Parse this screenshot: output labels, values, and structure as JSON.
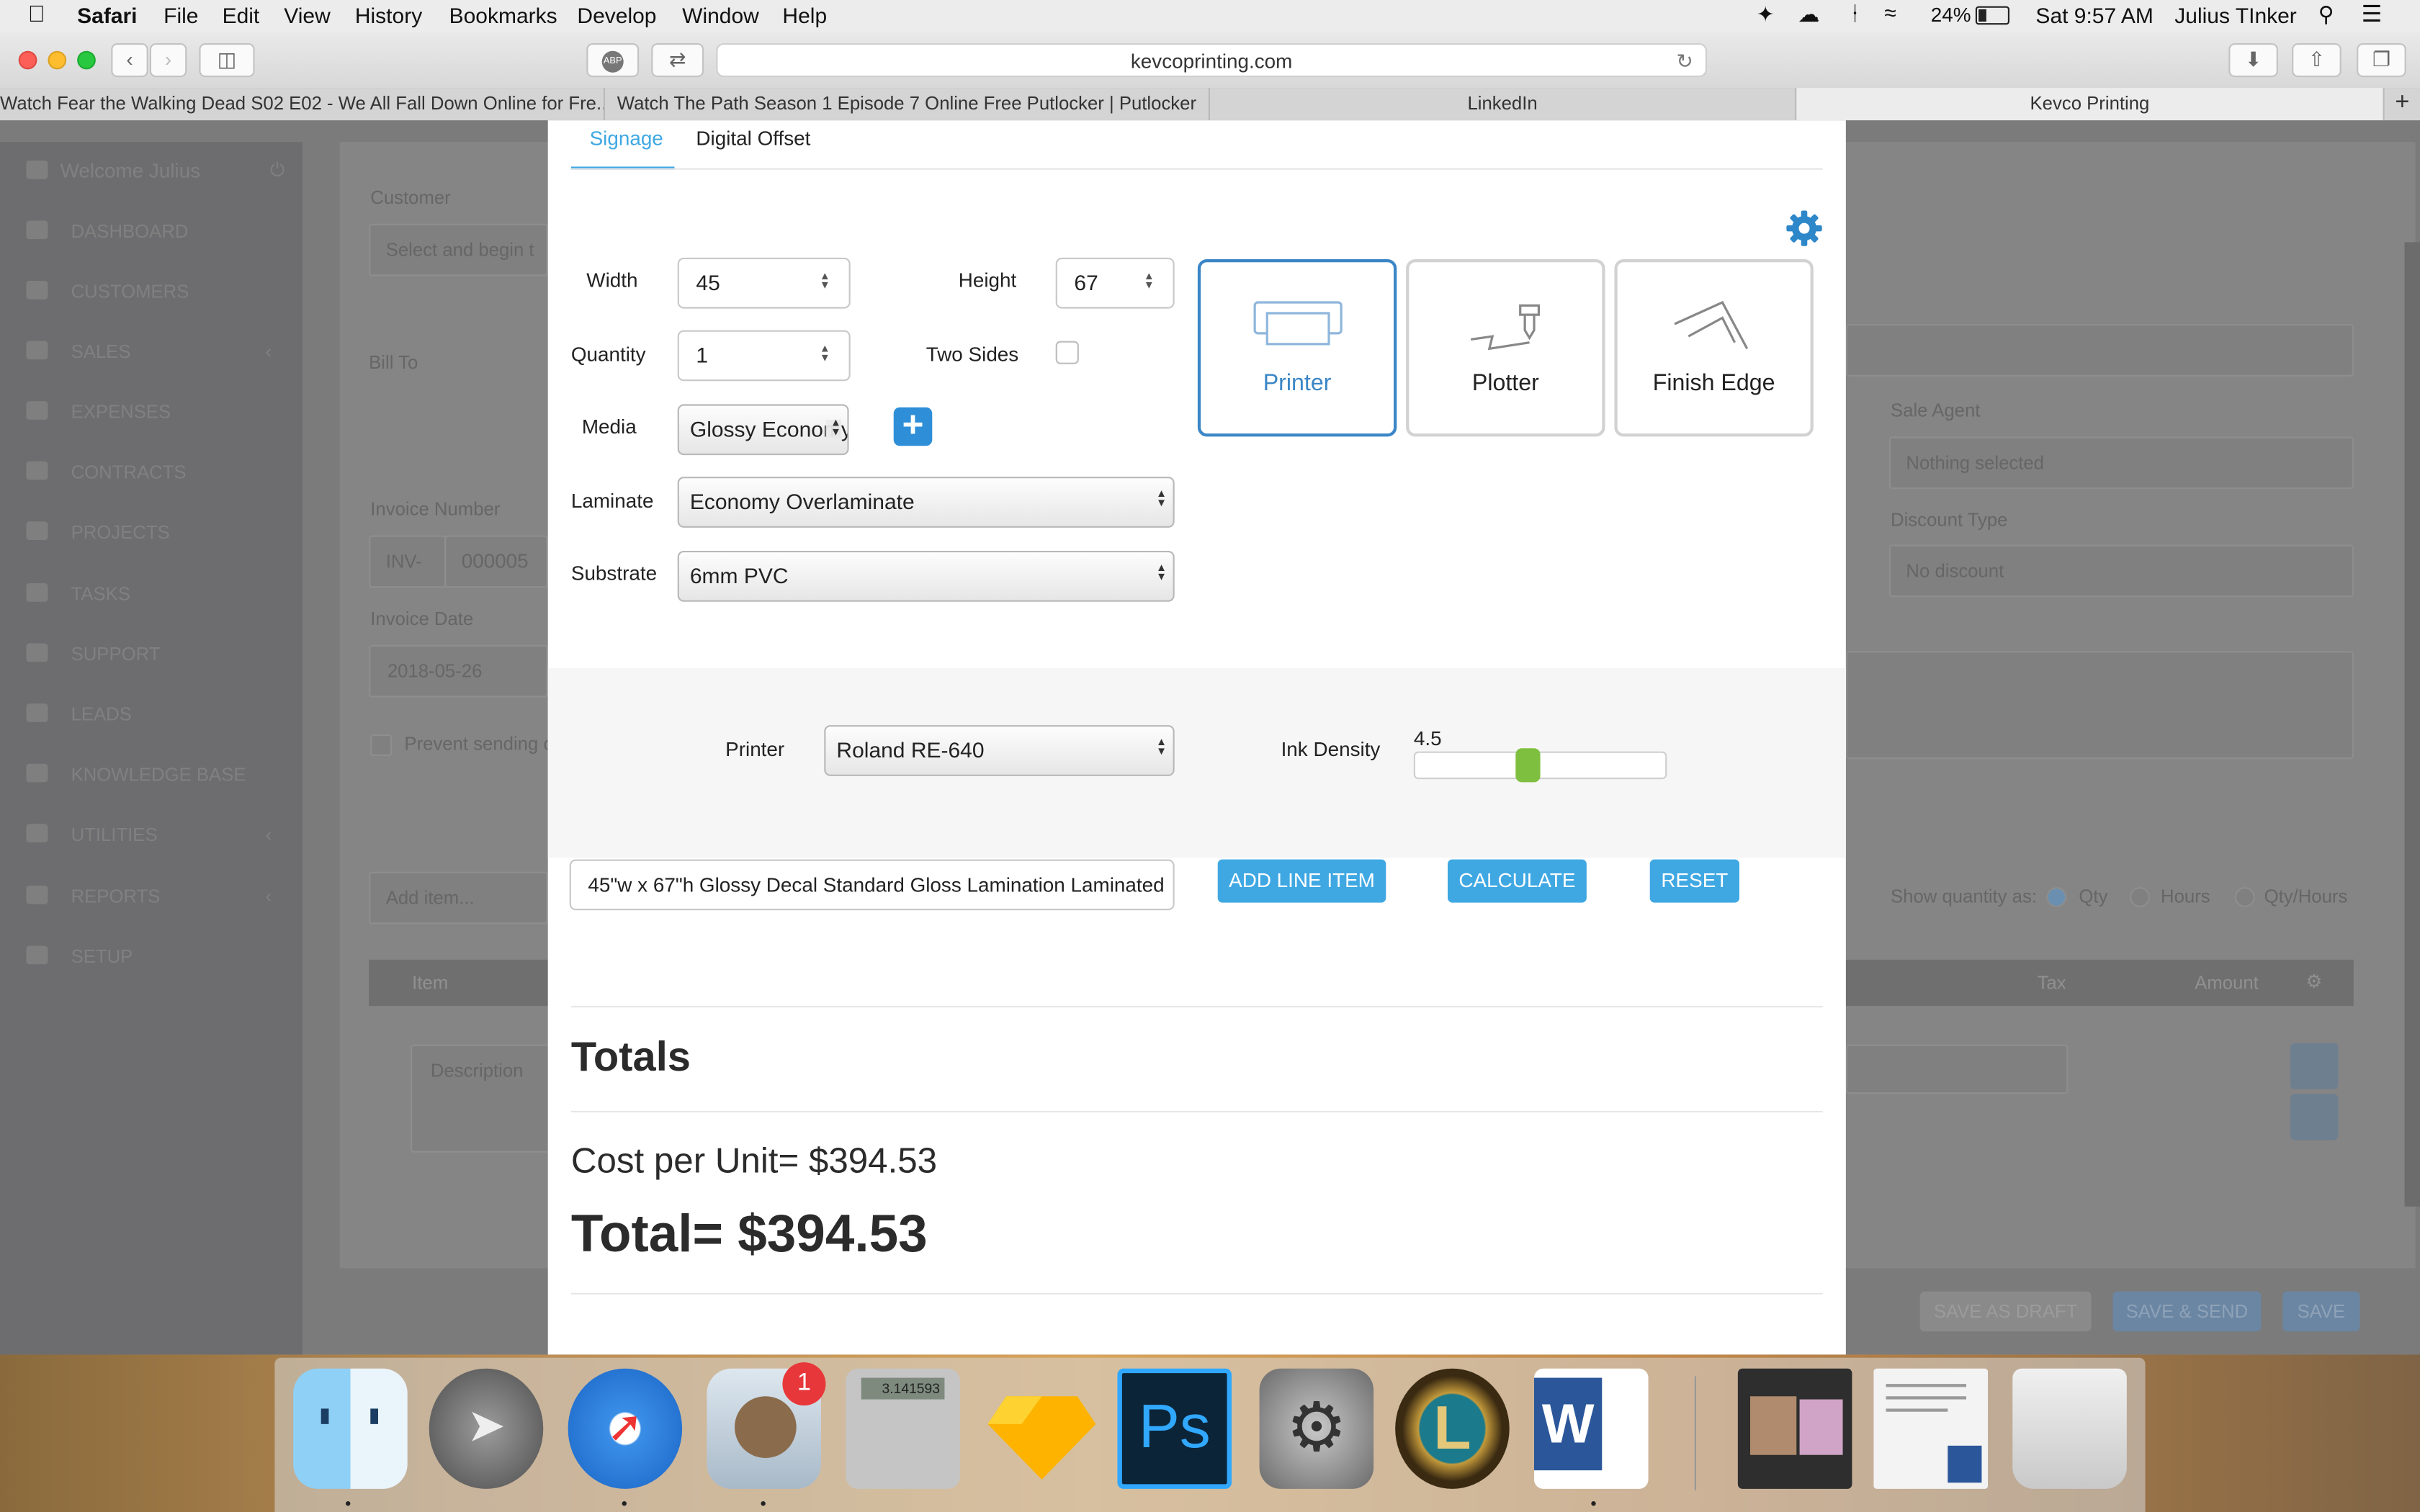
{
  "menubar": {
    "app": "Safari",
    "items": [
      "File",
      "Edit",
      "View",
      "History",
      "Bookmarks",
      "Develop",
      "Window",
      "Help"
    ],
    "battery": "24%",
    "clock": "Sat 9:57 AM",
    "user": "Julius TInker"
  },
  "browser": {
    "url": "kevcoprinting.com",
    "tabs": [
      "Watch Fear the Walking Dead S02 E02 - We All Fall Down Online for Fre...",
      "Watch The Path Season 1 Episode 7 Online Free Putlocker | Putlocker",
      "LinkedIn",
      "Kevco Printing"
    ],
    "active_tab": "Kevco Printing"
  },
  "sidebar": {
    "welcome": "Welcome Julius",
    "items": [
      "DASHBOARD",
      "CUSTOMERS",
      "SALES",
      "EXPENSES",
      "CONTRACTS",
      "PROJECTS",
      "TASKS",
      "SUPPORT",
      "LEADS",
      "KNOWLEDGE BASE",
      "UTILITIES",
      "REPORTS",
      "SETUP"
    ]
  },
  "background_form": {
    "customer_label": "Customer",
    "customer_placeholder": "Select and begin t",
    "bill_to": "Bill To",
    "invoice_number_label": "Invoice Number",
    "invoice_prefix": "INV-",
    "invoice_number": "000005",
    "invoice_date_label": "Invoice Date",
    "invoice_date": "2018-05-26",
    "prevent_sending": "Prevent sending o",
    "sale_agent_label": "Sale Agent",
    "sale_agent_value": "Nothing selected",
    "discount_type_label": "Discount Type",
    "discount_type_value": "No discount",
    "add_item_placeholder": "Add item...",
    "show_qty_label": "Show quantity as:",
    "qty_options": [
      "Qty",
      "Hours",
      "Qty/Hours"
    ],
    "table_item": "Item",
    "table_tax": "Tax",
    "table_amount": "Amount",
    "description_placeholder": "Description",
    "buttons": [
      "SAVE AS DRAFT",
      "SAVE & SEND",
      "SAVE"
    ]
  },
  "calculator": {
    "tabs": [
      "Signage",
      "Digital Offset"
    ],
    "active_tab": "Signage",
    "width_label": "Width",
    "width": "45",
    "height_label": "Height",
    "height": "67",
    "quantity_label": "Quantity",
    "quantity": "1",
    "two_sides_label": "Two Sides",
    "two_sides_checked": false,
    "media_label": "Media",
    "media": "Glossy Economy",
    "laminate_label": "Laminate",
    "laminate": "Economy Overlaminate",
    "substrate_label": "Substrate",
    "substrate": "6mm PVC",
    "tools": [
      "Printer",
      "Plotter",
      "Finish Edge"
    ],
    "selected_tool": "Printer",
    "printer_label": "Printer",
    "printer": "Roland RE-640",
    "ink_density_label": "Ink Density",
    "ink_density": "4.5",
    "ink_density_fraction": 0.45,
    "description": "45\"w x 67\"h Glossy Decal Standard Gloss Lamination Laminated",
    "buttons": {
      "add_line_item": "ADD LINE ITEM",
      "calculate": "CALCULATE",
      "reset": "RESET"
    },
    "totals_title": "Totals",
    "cost_per_unit": "Cost per Unit= $394.53",
    "total": "Total= $394.53",
    "accent_color": "#3fa8e3"
  },
  "dock": {
    "apps": [
      "Finder",
      "Launchpad",
      "Safari",
      "Mail",
      "Calculator",
      "Sketch",
      "Photoshop",
      "System Preferences",
      "League of Legends",
      "Microsoft Word",
      "Photos Folder",
      "Document",
      "Trash"
    ],
    "mail_badge": "1",
    "photoshop_label": "Ps",
    "word_label": "W",
    "calculator_display": "3.141593"
  }
}
